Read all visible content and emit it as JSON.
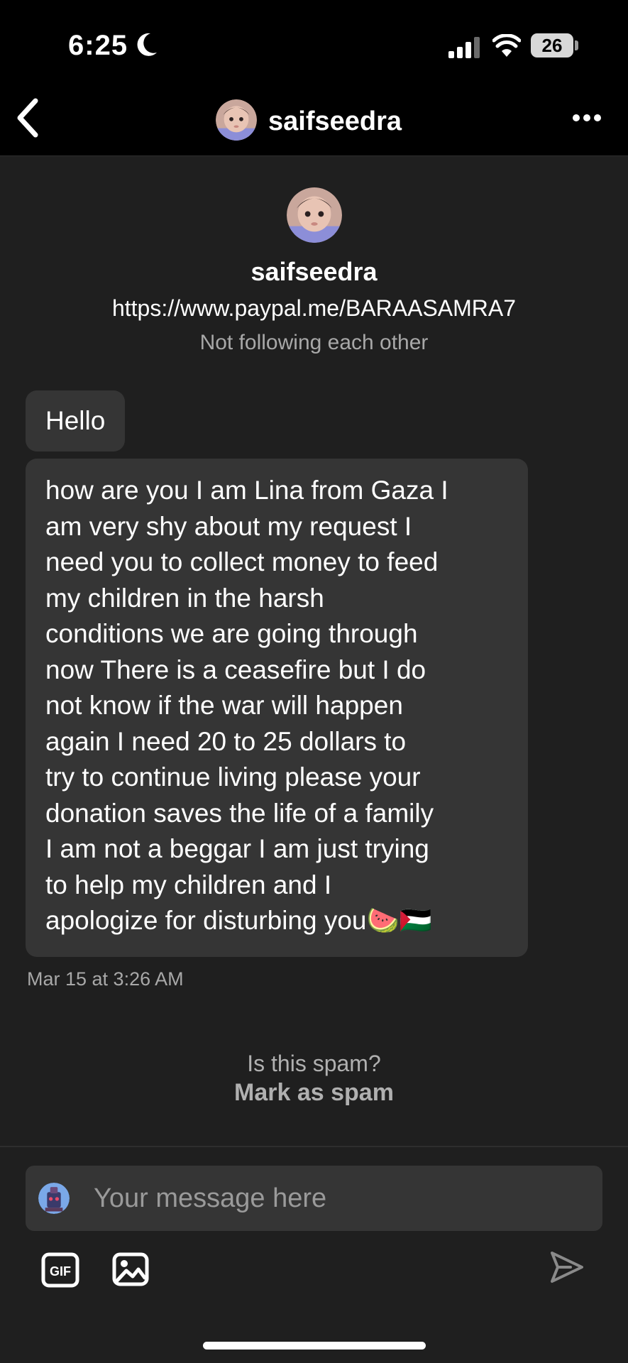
{
  "status_bar": {
    "time": "6:25",
    "battery": "26"
  },
  "header": {
    "title": "saifseedra"
  },
  "profile": {
    "name": "saifseedra",
    "link": "https://www.paypal.me/BARAASAMRA7",
    "relationship": "Not following each other"
  },
  "messages": [
    {
      "text": "Hello"
    },
    {
      "text": "how are you I am Lina from Gaza I\nam very shy about my request I\nneed you to collect money to feed\nmy children in the harsh\nconditions we are going through\nnow There is a ceasefire but I do\nnot know if the war will happen\nagain I need 20 to 25 dollars to\ntry to continue living please your\ndonation saves the life of a family\nI am not a beggar I am just trying\nto help my children and I\napologize for disturbing you🍉🇵🇸"
    }
  ],
  "timestamp": "Mar 15 at 3:26 AM",
  "spam": {
    "question": "Is this spam?",
    "action": "Mark as spam"
  },
  "composer": {
    "placeholder": "Your message here",
    "gif_label": "GIF"
  },
  "icons": {
    "back": "chevron-left-icon",
    "more": "more-horizontal-icon",
    "moon": "moon-icon",
    "signal": "cellular-signal-icon",
    "wifi": "wifi-icon",
    "gif": "gif-icon",
    "image": "image-icon",
    "send": "send-icon"
  },
  "colors": {
    "background": "#1f1f1f",
    "bubble": "#353535",
    "bars": "#000000",
    "muted_text": "#a8a8a8"
  }
}
